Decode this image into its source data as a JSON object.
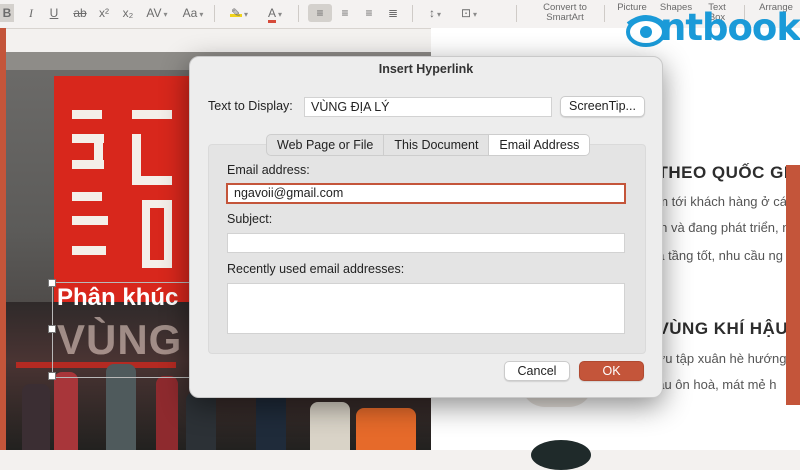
{
  "toolbar": {
    "bold": "B",
    "italic": "I",
    "underline": "U",
    "strike": "ab",
    "superscript": "x²",
    "subscript": "x₂",
    "char_spacing": "AV",
    "change_case": "Aa",
    "font_color": "A",
    "convert_smartart_line1": "Convert to",
    "convert_smartart_line2": "SmartArt",
    "picture": "Picture",
    "shapes": "Shapes",
    "textbox_line1": "Text",
    "textbox_line2": "Box",
    "arrange": "Arrange"
  },
  "logo": {
    "text": "ntbook"
  },
  "slide": {
    "overlay_title": "Phân khúc",
    "overlay_big": "VÙNG",
    "heading_1": ". THEO QUỐC GIA",
    "line_1": "ẩm tới khách hàng ở các",
    "line_2": "iển và đang phát triển, n",
    "line_3": "hạ tầng tốt, nhu cầu ng",
    "heading_2": ". VÙNG KHÍ HẬU",
    "line_4": "sưu tập xuân hè hướng",
    "line_5": "hậu ôn hoà, mát mẻ h"
  },
  "dialog": {
    "title": "Insert Hyperlink",
    "text_to_display_label": "Text to Display:",
    "text_to_display_value": "VÙNG ĐỊA LÝ",
    "screentip_button": "ScreenTip...",
    "tabs": [
      {
        "label": "Web Page or File",
        "active": false
      },
      {
        "label": "This Document",
        "active": false
      },
      {
        "label": "Email Address",
        "active": true
      }
    ],
    "email_label": "Email address:",
    "email_value": "ngavoii@gmail.com",
    "subject_label": "Subject:",
    "subject_value": "",
    "recent_label": "Recently used email addresses:",
    "cancel_button": "Cancel",
    "ok_button": "OK"
  },
  "colors": {
    "accent": "#c4553a",
    "logo_blue": "#1a9ad8",
    "sign_red": "#d8271c",
    "highlight_yellow": "#f0d31c"
  }
}
